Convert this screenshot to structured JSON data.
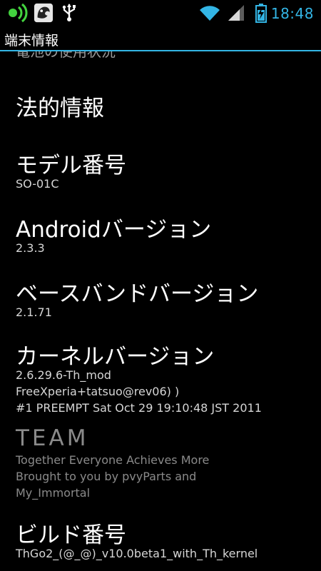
{
  "status_bar": {
    "time": "18:48",
    "icons": {
      "left": [
        "ringtone-mode-icon",
        "app-notification-icon",
        "usb-icon"
      ],
      "right": [
        "wifi-icon",
        "signal-icon",
        "battery-charging-icon"
      ]
    },
    "accent_color": "#33b5e5"
  },
  "title_bar": {
    "title": "端末情報"
  },
  "list": {
    "clipped_previous_title": "電池の使用状況",
    "items": [
      {
        "title": "法的情報",
        "subtitle": []
      },
      {
        "title": "モデル番号",
        "subtitle": [
          "SO-01C"
        ]
      },
      {
        "title": "Androidバージョン",
        "subtitle": [
          "2.3.3"
        ]
      },
      {
        "title": "ベースバンドバージョン",
        "subtitle": [
          "2.1.71"
        ]
      },
      {
        "title": "カーネルバージョン",
        "subtitle": [
          "2.6.29.6-Th_mod",
          "FreeXperia+tatsuo@rev06) )",
          "#1 PREEMPT Sat Oct 29 19:10:48 JST 2011"
        ]
      },
      {
        "title": "TEAM",
        "subtitle": [
          "Together Everyone Achieves More",
          "Brought to you by pvyParts and",
          "My_Immortal"
        ],
        "disabled": true
      },
      {
        "title": "ビルド番号",
        "subtitle": [
          "ThGo2_(@_@)_v10.0beta1_with_Th_kernel"
        ]
      }
    ]
  }
}
